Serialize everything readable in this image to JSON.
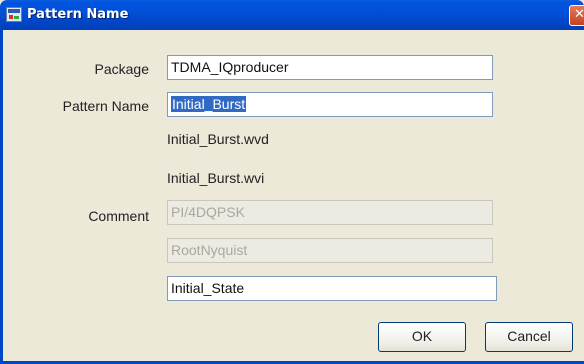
{
  "window": {
    "title": "Pattern Name",
    "close_glyph": "✕"
  },
  "form": {
    "package": {
      "label": "Package",
      "value": "TDMA_IQproducer"
    },
    "pattern_name": {
      "label": "Pattern Name",
      "value": "Initial_Burst"
    },
    "wvd_file": "Initial_Burst.wvd",
    "wvi_file": "Initial_Burst.wvi",
    "comment": {
      "label": "Comment",
      "line1": "PI/4DQPSK",
      "line2": "RootNyquist",
      "line3": "Initial_State"
    }
  },
  "buttons": {
    "ok": "OK",
    "cancel": "Cancel"
  }
}
